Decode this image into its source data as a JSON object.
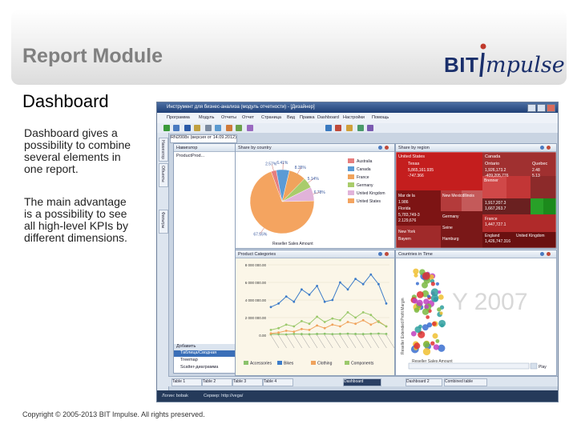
{
  "slide": {
    "title": "Report Module",
    "heading": "Dashboard",
    "paragraph1_lines": [
      "Dashboard gives a",
      "possibility to combine",
      "several elements in",
      "one report."
    ],
    "paragraph2_lines": [
      "The main advantage",
      "is a possibility to see",
      "all high-level KPIs by",
      "different dimensions."
    ],
    "footer": "Copyright © 2005-2013 BIT Impulse. All rights preserved."
  },
  "logo": {
    "text_bit": "BIT",
    "text_impulse": "mpulse",
    "brand_color": "#1a2f6b",
    "accent_color": "#c0392b"
  },
  "app": {
    "window_title": "Инструмент для бизнес-анализа (модуль отчетности) - [Дизайнер]",
    "menu": [
      "Программа",
      "Модуль",
      "Отчеты",
      "Отчет",
      "Страница",
      "Вид",
      "Правка",
      "Dashboard",
      "Настройки",
      "Помощь"
    ],
    "doc_tab": "RN2008x (версия от 14.09.2012)",
    "side_tabs": [
      "Навигатор",
      "Объекты",
      "Фильтры"
    ],
    "panels": {
      "navigator": {
        "title": "Навигатор",
        "tree_item": "ProductProd...",
        "added_header": "Добавить",
        "items": [
          "Таблица/Сводная",
          "Treemap",
          "Scatter-диаграмма"
        ]
      },
      "pie": {
        "title": "Share by country",
        "legend": [
          "Australia",
          "Canada",
          "France",
          "Germany",
          "United Kingdom",
          "United States"
        ],
        "measure": "Reseller Sales Amount"
      },
      "treemap": {
        "title": "Share by region",
        "cells": [
          "United States",
          "Canada",
          "Texas",
          "Ontario",
          "Quebec",
          "Mar de la",
          "New Mexico",
          "Illinois",
          "Brenner",
          "Florida",
          "New York",
          "England",
          "United Kingdom",
          "France",
          "Germany",
          "Seine",
          "Bayern",
          "Hamburg"
        ],
        "values": [
          "5,865,161.935",
          "1,926,173.2",
          "-747.366",
          "-409,205,776",
          "2.48",
          "5.13",
          "1.986",
          "5,783,749-3",
          "2.129,676",
          "1,917,207.3",
          "1,667,263.7",
          "1,447,727.1",
          "1,426,747.316"
        ]
      },
      "line": {
        "title": "Product Categories"
      },
      "scatter": {
        "title": "Countries in Time",
        "year_label": "Y 2007",
        "y_axis_title": "Reseller Extended Profit Margin",
        "x_axis_title": "Reseller Sales Amount",
        "play_label": "Play"
      }
    },
    "bottom_tabs": [
      "Table 1",
      "Table 2",
      "Table 3",
      "Table 4",
      "Dashboard",
      "Dashboard 2",
      "Combined table"
    ],
    "status": {
      "user": "Логин: bobak",
      "server": "Сервер: http://vega/"
    }
  },
  "chart_data": [
    {
      "type": "pie",
      "title": "Share by country",
      "categories": [
        "Australia",
        "Canada",
        "France",
        "Germany",
        "United Kingdom",
        "United States"
      ],
      "values": [
        2.57,
        6.41,
        8.35,
        5.14,
        6.78,
        67.55
      ],
      "data_labels": [
        "2.57%",
        "6.41%",
        "8.35%",
        "5.14%",
        "6.78%",
        "67.55%"
      ],
      "xlabel": "Reseller Sales Amount",
      "colors": [
        "#e67e7e",
        "#5b9bd5",
        "#f0a35c",
        "#a9cc6b",
        "#e1b3d9",
        "#f4a460"
      ]
    },
    {
      "type": "line",
      "title": "Product Categories",
      "ylim": [
        0,
        8000000
      ],
      "y_ticks": [
        "0.00",
        "2 000 000.00",
        "4 000 000.00",
        "6 000 000.00",
        "8 000 000.00"
      ],
      "legend": [
        "Accessories",
        "Bikes",
        "Clothing",
        "Components"
      ],
      "series": [
        {
          "name": "Accessories",
          "color": "#8ac26b",
          "values": [
            100000,
            120000,
            90000,
            150000,
            130000,
            110000,
            140000,
            160000,
            120000,
            150000,
            170000,
            140000,
            130000,
            160000,
            180000,
            150000
          ]
        },
        {
          "name": "Bikes",
          "color": "#3d7cc9",
          "values": [
            3200000,
            3600000,
            4400000,
            3800000,
            5200000,
            4600000,
            5600000,
            3800000,
            4000000,
            6000000,
            5200000,
            6400000,
            5800000,
            6900000,
            5800000,
            3600000
          ]
        },
        {
          "name": "Clothing",
          "color": "#f0a35c",
          "values": [
            200000,
            300000,
            500000,
            400000,
            700000,
            600000,
            1100000,
            800000,
            1200000,
            1000000,
            1500000,
            1300000,
            1700000,
            1200000,
            1600000,
            1000000
          ]
        },
        {
          "name": "Components",
          "color": "#9bc96b",
          "values": [
            600000,
            800000,
            1200000,
            1000000,
            1600000,
            1300000,
            2100000,
            1500000,
            1900000,
            1700000,
            2600000,
            2000000,
            2600000,
            2300000,
            1500000,
            1000000
          ]
        }
      ]
    }
  ]
}
